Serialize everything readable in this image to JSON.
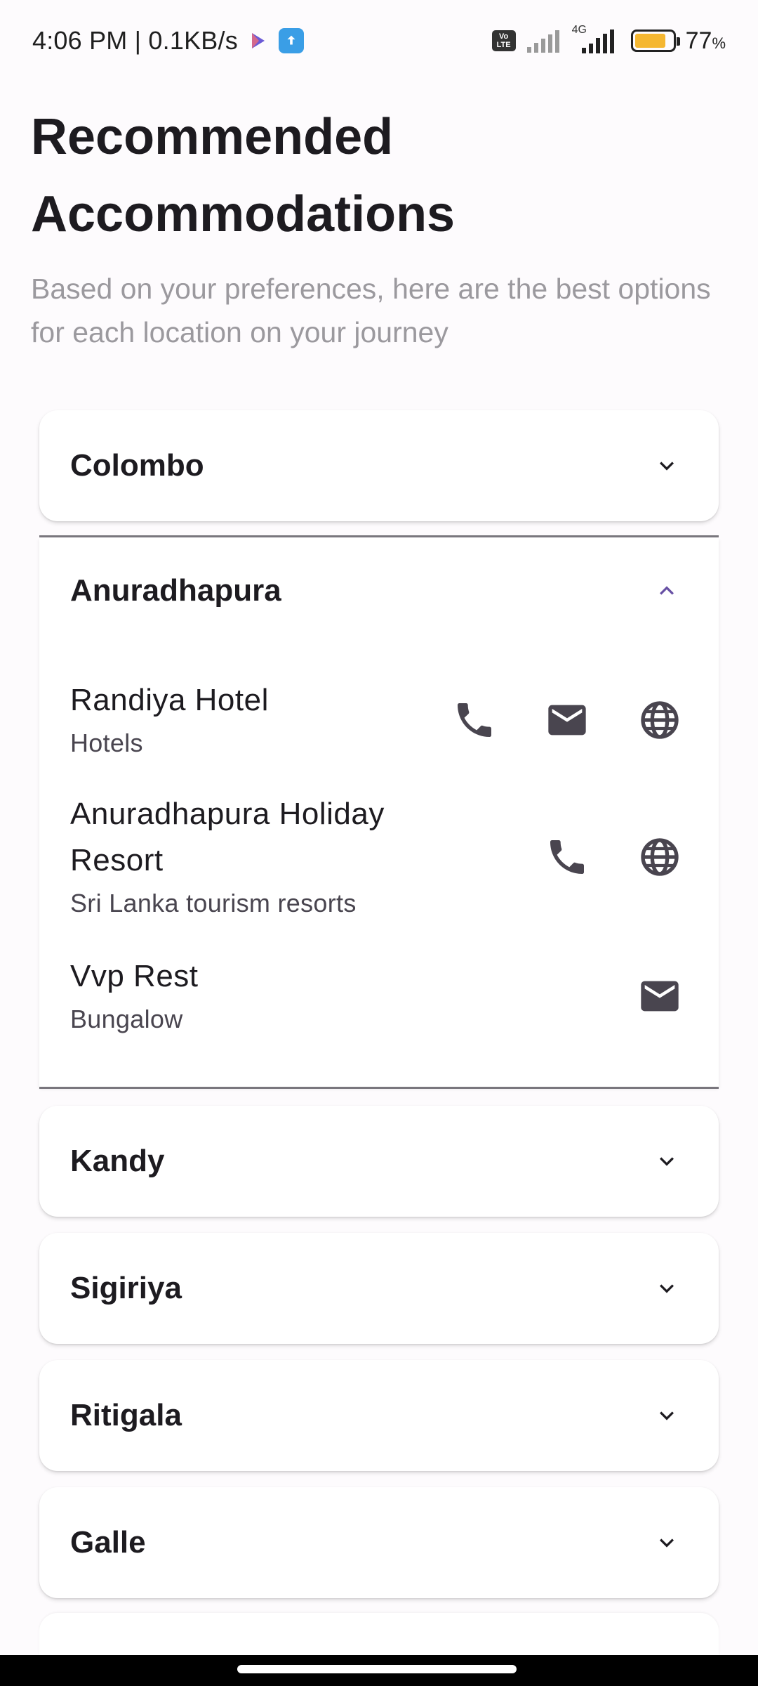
{
  "status_bar": {
    "time": "4:06 PM | 0.1KB/s",
    "network": "4G",
    "volte": "Vo LTE",
    "battery_percent": "77",
    "battery_unit": "%",
    "battery_level": 0.77,
    "battery_color": "#f5b731"
  },
  "header": {
    "title": "Recommended Accommodations",
    "subtitle": "Based on your preferences, here are the best options for each location on your journey"
  },
  "locations": [
    {
      "name": "Colombo",
      "expanded": false
    },
    {
      "name": "Anuradhapura",
      "expanded": true,
      "items": [
        {
          "name": "Randiya Hotel",
          "category": "Hotels",
          "actions": [
            "phone-icon",
            "mail-icon",
            "globe-icon"
          ]
        },
        {
          "name": "Anuradhapura Holiday Resort",
          "category": "Sri Lanka tourism resorts",
          "actions": [
            "phone-icon",
            "globe-icon"
          ]
        },
        {
          "name": "Vvp Rest",
          "category": "Bungalow",
          "actions": [
            "mail-icon"
          ]
        }
      ]
    },
    {
      "name": "Kandy",
      "expanded": false
    },
    {
      "name": "Sigiriya",
      "expanded": false
    },
    {
      "name": "Ritigala",
      "expanded": false
    },
    {
      "name": "Galle",
      "expanded": false
    }
  ],
  "colors": {
    "accent": "#6750a4",
    "icon": "#49454f",
    "subtitle": "#9b999e"
  }
}
